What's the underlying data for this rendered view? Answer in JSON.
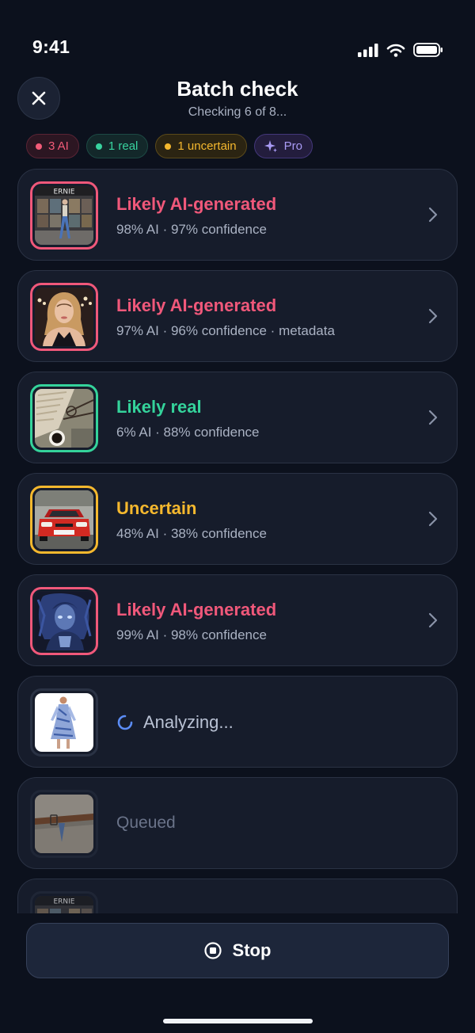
{
  "status_bar": {
    "time": "9:41"
  },
  "header": {
    "title": "Batch check",
    "subtitle": "Checking 6 of 8..."
  },
  "filters": {
    "ai": "3 AI",
    "real": "1 real",
    "uncertain": "1 uncertain",
    "pro": "Pro"
  },
  "thumbnail_texts": {
    "item1_sign": "ERNIE",
    "item8_sign": "ERNIE"
  },
  "items": [
    {
      "status": "ai",
      "verdict": "Likely AI-generated",
      "details": "98% AI · 97% confidence"
    },
    {
      "status": "ai",
      "verdict": "Likely AI-generated",
      "details": "97% AI · 96% confidence · metadata"
    },
    {
      "status": "real",
      "verdict": "Likely real",
      "details": "6% AI · 88% confidence"
    },
    {
      "status": "uncertain",
      "verdict": "Uncertain",
      "details": "48% AI · 38% confidence"
    },
    {
      "status": "ai",
      "verdict": "Likely AI-generated",
      "details": "99% AI · 98% confidence"
    },
    {
      "status": "analyzing",
      "label": "Analyzing..."
    },
    {
      "status": "queued",
      "label": "Queued"
    },
    {
      "status": "queued"
    }
  ],
  "colors": {
    "ai": "#f0587a",
    "real": "#34d39b",
    "uncertain": "#f5b82e",
    "pro": "#a99bf5",
    "analyzing": "#5b8cf5"
  },
  "actions": {
    "stop": "Stop"
  }
}
